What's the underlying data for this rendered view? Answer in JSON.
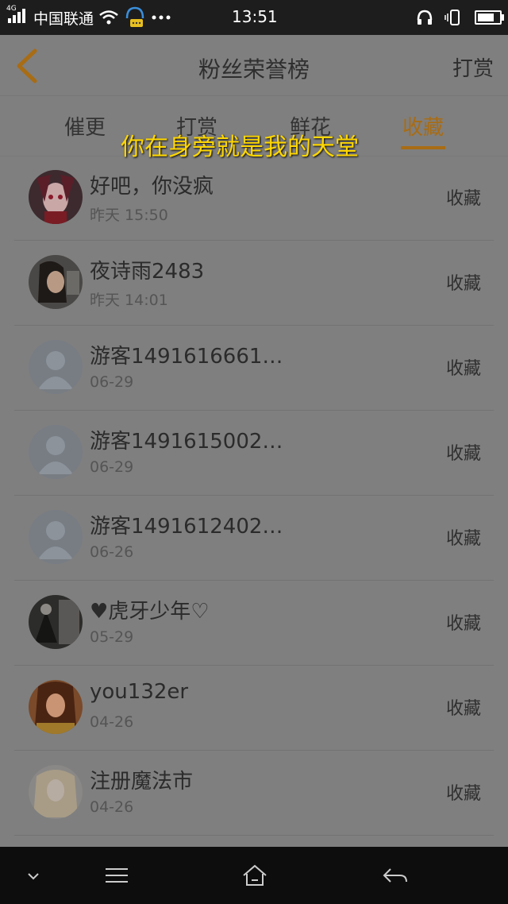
{
  "status_bar": {
    "network": "4G",
    "carrier": "中国联通",
    "time": "13:51",
    "battery_level": 0.75
  },
  "nav": {
    "title": "粉丝荣誉榜",
    "action": "打赏"
  },
  "tabs": [
    {
      "label": "催更",
      "active": false
    },
    {
      "label": "打赏",
      "active": false
    },
    {
      "label": "鲜花",
      "active": false
    },
    {
      "label": "收藏",
      "active": true
    }
  ],
  "overlay_caption": "你在身旁就是我的天堂",
  "rows": [
    {
      "name": "好吧，你没疯",
      "time": "昨天 15:50",
      "action": "收藏",
      "avatar": "anime-girl"
    },
    {
      "name": "夜诗雨2483",
      "time": "昨天 14:01",
      "action": "收藏",
      "avatar": "woman-photo"
    },
    {
      "name": "游客1491616661…",
      "time": "06-29",
      "action": "收藏",
      "avatar": "default-user"
    },
    {
      "name": "游客1491615002…",
      "time": "06-29",
      "action": "收藏",
      "avatar": "default-user"
    },
    {
      "name": "游客1491612402…",
      "time": "06-26",
      "action": "收藏",
      "avatar": "default-user"
    },
    {
      "name": "♥虎牙少年♡",
      "time": "05-29",
      "action": "收藏",
      "avatar": "dark-photo"
    },
    {
      "name": "you132er",
      "time": "04-26",
      "action": "收藏",
      "avatar": "woman-sticker"
    },
    {
      "name": "注册魔法市",
      "time": "04-26",
      "action": "收藏",
      "avatar": "blonde-photo"
    }
  ],
  "colors": {
    "accent": "#a86c14",
    "overlay_text": "#ffd700"
  }
}
